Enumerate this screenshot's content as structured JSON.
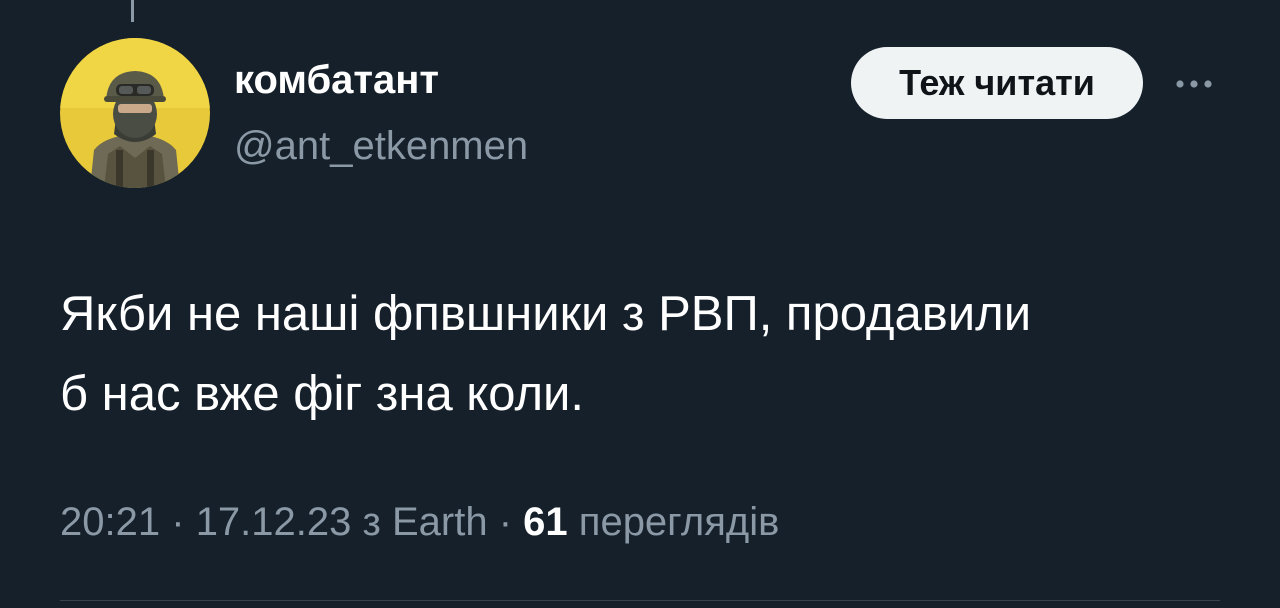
{
  "tweet": {
    "author_name": "комбатант",
    "author_handle": "@ant_etkenmen",
    "text_line1": "Якби не наші фпвшники з РВП, продавили",
    "text_line2": "б нас вже фіг зна коли.",
    "time": "20:21",
    "date": "17.12.23",
    "source": "з Earth",
    "separator": "·",
    "views_count": "61",
    "views_label": "переглядів"
  },
  "actions": {
    "follow_label": "Теж читати",
    "more_icon": "more-horizontal-icon"
  },
  "colors": {
    "background": "#15202b",
    "primary_text": "#ffffff",
    "secondary_text": "#8b98a5",
    "button_bg": "#eff3f4",
    "divider": "#38444d"
  }
}
